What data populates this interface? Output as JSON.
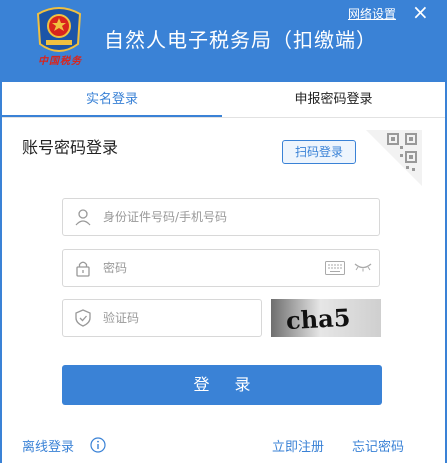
{
  "header": {
    "title": "自然人电子税务局（扣缴端）",
    "emblem_icon": "tax-emblem-icon",
    "logo_text": "中国税务",
    "network_settings": "网络设置",
    "close_symbol": "×",
    "brand_color": "#3a82d6"
  },
  "tabs": [
    {
      "label": "实名登录",
      "active": true
    },
    {
      "label": "申报密码登录",
      "active": false
    }
  ],
  "login": {
    "section_title": "账号密码登录",
    "qr_tip": "扫码登录",
    "id_placeholder": "身份证件号码/手机号码",
    "password_placeholder": "密码",
    "captcha_placeholder": "验证码",
    "captcha_text": "cha5",
    "submit_label": "登 录"
  },
  "footer": {
    "offline_login": "离线登录",
    "register": "立即注册",
    "forgot_password": "忘记密码"
  }
}
